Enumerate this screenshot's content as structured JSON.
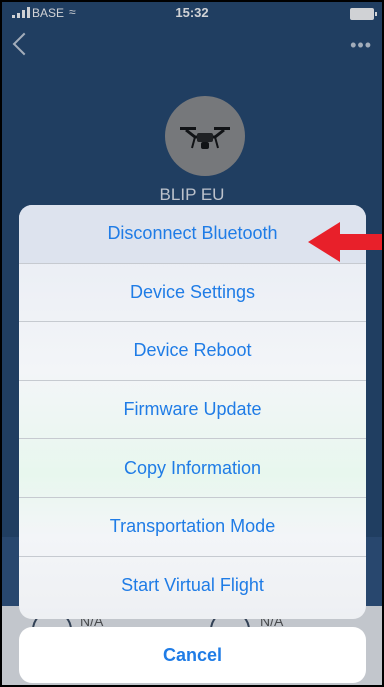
{
  "status_bar": {
    "carrier": "BASE",
    "time": "15:32"
  },
  "header": {
    "back_icon": "chevron-left-icon",
    "more_icon": "ellipsis-icon"
  },
  "device": {
    "name": "BLIP EU"
  },
  "background_values": {
    "left": "N/A",
    "right": "N/A"
  },
  "action_sheet": {
    "actions": [
      {
        "label": "Disconnect Bluetooth"
      },
      {
        "label": "Device Settings"
      },
      {
        "label": "Device Reboot"
      },
      {
        "label": "Firmware Update"
      },
      {
        "label": "Copy Information"
      },
      {
        "label": "Transportation Mode"
      },
      {
        "label": "Start Virtual Flight"
      }
    ],
    "cancel_label": "Cancel"
  },
  "colors": {
    "accent": "#1f7ce6",
    "app_background": "#24466f",
    "annotation_arrow": "#e8202a"
  }
}
